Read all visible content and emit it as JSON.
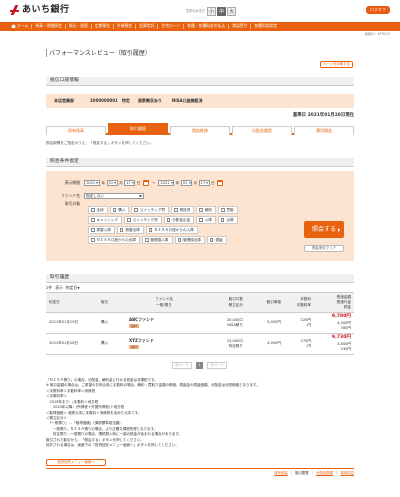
{
  "header": {
    "bank_name": "あいち銀行",
    "fontsize_label": "文字の大きさ",
    "fontsize_options": [
      "小",
      "中",
      "大"
    ],
    "fontsize_selected": "中",
    "logout_label": "ログオフ"
  },
  "gnav": {
    "items": [
      "ホーム",
      "残高・明細照会",
      "振込・振替",
      "定期預金",
      "外貨預金",
      "投資信託",
      "住宅ローン",
      "各種・各種料金の払込",
      "諸届受付",
      "各種利用設定"
    ]
  },
  "page": {
    "screen_id": "画面ID：BFR103",
    "title": "パフォーマンスレビュー（取引履歴）",
    "print_label": "ページを印刷する"
  },
  "account": {
    "section_title": "投信口座情報",
    "branch": "本店営業部",
    "number": "2000000001",
    "type": "特定",
    "withholding": "源泉徴収あり",
    "nisa": "NISA口座開設済",
    "base_date": "基準日 2021年01月20日現在"
  },
  "tabs": [
    {
      "label": "保有残高",
      "active": false
    },
    {
      "label": "取引履歴",
      "active": true
    },
    {
      "label": "損益推移",
      "active": false
    },
    {
      "label": "分配金履歴",
      "active": false
    },
    {
      "label": "運用損益",
      "active": false
    }
  ],
  "note_top": "照会期間をご指定のうえ、「照会する」ボタンを押してください。",
  "search": {
    "section_title": "照会条件指定",
    "period_label": "表示期間",
    "from": {
      "year": "2021",
      "month": "01",
      "day": "17"
    },
    "to": {
      "year": "2021",
      "month": "01",
      "day": "17"
    },
    "unit_year": "年",
    "unit_month": "月",
    "unit_day": "日",
    "tilde": "〜",
    "fund_label": "ファンド名",
    "fund_value": "指定しない",
    "target_label": "取引対象",
    "checkboxes": [
      [
        "全体",
        "購入",
        "スイッチング買",
        "再投資",
        "解約",
        "買取"
      ],
      [
        "キャッシング",
        "スイッチング売",
        "分配金出金",
        "入庫",
        "出庫"
      ],
      [
        "振替入庫",
        "振替出庫",
        "ＮＩＳＡ口座からの入庫"
      ],
      [
        "ＮＩＳＡ口座からの出庫",
        "管理換入庫",
        "管理換出庫",
        "償還"
      ]
    ],
    "search_button": "照会する",
    "clear_button": "照会条件クリア"
  },
  "history": {
    "section_title": "取引履歴",
    "count": "2件",
    "count_sep": "表示",
    "sort_label": "約定日",
    "sort_mark": "▼",
    "columns": [
      [
        "約定日"
      ],
      [
        "取引"
      ],
      [
        "ファンド名",
        "一般/預り"
      ],
      [
        "取引口数",
        "積立区分"
      ],
      [
        "取引単価"
      ],
      [
        "手数料",
        "手数料率"
      ],
      [
        "受渡金額",
        "受渡代金",
        "税金"
      ]
    ],
    "rows": [
      {
        "date": "2021年01月19日",
        "trade": "購入",
        "fund": "ABCファンド",
        "tag": "買付",
        "units": "20,000口",
        "units_sub": "NISA積り",
        "price": "5,000円",
        "fee": "220円",
        "fee_sub": "-円",
        "amount": "9,780円",
        "amount_sub1": "4,500円",
        "amount_sub2": "780円"
      },
      {
        "date": "2021年01月18日",
        "trade": "購入",
        "fund": "XYZファンド",
        "tag": "買付",
        "units": "25,000口",
        "units_sub": "特定積り",
        "price": "4,000円",
        "fee": "270円",
        "fee_sub": "-円",
        "amount": "9,730円",
        "amount_sub1": "3,800円",
        "amount_sub2": "230円"
      }
    ],
    "pager": {
      "prev": "前ページ",
      "page": "1",
      "next": "次ページ"
    }
  },
  "notes": [
    "「ＮＩＳＡ預り」の場合、分配金、解約金に行かる税金は非課税です。",
    "※ 取引金額の場合は、ご希望のお申込前に手数料の場合、解約・買取り金額の照価、償還金の償還価額、分配金は分配価格となります。",
    "＜手数料率＞手数料率＝消費税",
    "＜手数料率＞",
    "　2019年まで：(手数料＋地方税",
    "　　2020年以降：(所得税＋外国所得税)＋地方税",
    "＜取得価格＞ 個別元本に手数料＋消費税を含めた元本です。",
    "＜積立区分＞",
    "　「一般預り」…「取得価額」(課税標準相当額)",
    "　　一般預り、ＮＩＳＡ預りの場合、より正確な課税所得となります。",
    "　　特定預り…一般預りの場合、課税算入時に一部の税金が含まれる場合があります。",
    "取引された取引から、「照会する」ボタンを押してください。",
    "　",
    "除外される場合は、画面下の「投資信託メニュー画面へ」ボタンを押してください。"
  ],
  "footer": {
    "back_button": "投資信託メニュー画面へ",
    "breadcrumb": [
      "保有残高",
      "取引履歴",
      "分配金履歴",
      "運用損益"
    ],
    "breadcrumb_sep": "｜"
  },
  "colors": {
    "accent": "#e8620f",
    "panel": "#fde4d0",
    "brand": "#c9171e"
  }
}
